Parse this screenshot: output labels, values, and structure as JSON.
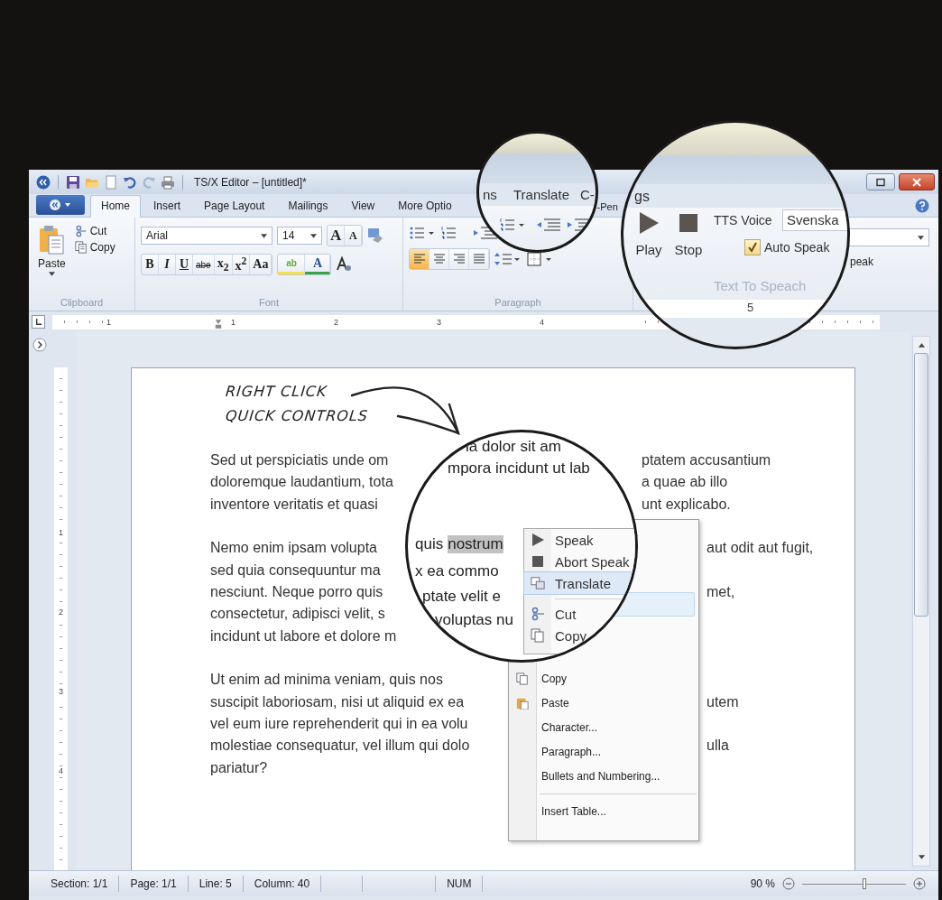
{
  "title_bar": {
    "title": "TS/X Editor – [untitled]*"
  },
  "tabs": [
    {
      "label": "Home",
      "selected": true
    },
    {
      "label": "Insert",
      "selected": false
    },
    {
      "label": "Page Layout",
      "selected": false
    },
    {
      "label": "Mailings",
      "selected": false
    },
    {
      "label": "View",
      "selected": false
    },
    {
      "label": "More Optio",
      "selected": false
    }
  ],
  "tabs_right": [
    {
      "label": "-Pen",
      "selected": false
    }
  ],
  "clipboard": {
    "paste": "Paste",
    "cut": "Cut",
    "copy": "Copy",
    "label": "Clipboard"
  },
  "font": {
    "family": "Arial",
    "size": "14",
    "grow": "A",
    "shrink": "A",
    "format_buttons": [
      "B",
      "I",
      "U",
      "abe",
      "x$_{2}$",
      "x$^{2}$",
      "Aa"
    ],
    "highlight": "ab",
    "color_button": "A",
    "label": "Font"
  },
  "paragraph": {
    "align_buttons": [
      {
        "kind": "left",
        "selected": true
      },
      {
        "kind": "center",
        "selected": false
      },
      {
        "kind": "right",
        "selected": false
      },
      {
        "kind": "justify",
        "selected": false
      }
    ],
    "label": "Paragraph"
  },
  "speak_fragment": "peak",
  "lens_tabs": [
    {
      "label": "ns",
      "selected": false
    },
    {
      "label": "Translate",
      "selected": false
    },
    {
      "label": "C-",
      "selected": false
    }
  ],
  "text_to_speech": {
    "tab_fragment": "gs",
    "play": "Play",
    "stop": "Stop",
    "voice_label": "TTS Voice",
    "voice": "Svenska",
    "auto_speak": {
      "label": "Auto Speak",
      "checked": true
    },
    "label": "Text To Speach",
    "ruler_mark": "5"
  },
  "ruler": {
    "marks": [
      "1",
      "1",
      "2",
      "3",
      "4"
    ]
  },
  "vertical_ruler": {
    "marks": [
      "1",
      "2",
      "3",
      "4"
    ]
  },
  "annotation": {
    "lines": [
      "RIGHT CLICK",
      "QUICK CONTROLS"
    ]
  },
  "document": {
    "paragraphs": [
      {
        "lines": [
          {
            "left": "Sed ut perspiciatis unde om",
            "right": "ptatem accusantium"
          },
          {
            "left": "doloremque laudantium, tota",
            "right": "a quae ab illo"
          },
          {
            "left": "inventore veritatis et quasi",
            "right": "unt explicabo."
          }
        ]
      },
      {
        "lines": [
          {
            "left": "Nemo enim ipsam volupta",
            "right": "aut odit aut fugit,"
          },
          {
            "left": "sed quia consequuntur ma"
          },
          {
            "left": "nesciunt. Neque porro quis",
            "right": "met,"
          },
          {
            "left": "consectetur, adipisci velit, s"
          },
          {
            "left": "incidunt ut labore et dolore m"
          }
        ]
      },
      {
        "lines": [
          {
            "left": "Ut enim ad minima veniam, quis nos"
          },
          {
            "left": "suscipit laboriosam, nisi ut aliquid ex ea",
            "right": "utem"
          },
          {
            "left": "vel eum iure reprehenderit qui in ea volu"
          },
          {
            "left": "molestiae consequatur, vel illum qui dolo",
            "right": "ulla"
          },
          {
            "left": "pariatur?"
          }
        ]
      }
    ]
  },
  "magnified_document": {
    "lines": [
      {
        "text": "ia dolor sit am"
      },
      {
        "text": "mpora incidunt ut lab"
      },
      {
        "text": "quis",
        "highlight": "nostrum"
      },
      {
        "text": "x ea commo"
      },
      {
        "text": "ptate velit e"
      },
      {
        "text": "voluptas nu"
      }
    ]
  },
  "context_menu": {
    "magnified_items": [
      {
        "kind": "speak",
        "label": "Speak",
        "selected": false
      },
      {
        "kind": "stop",
        "label": "Abort Speak",
        "selected": false
      },
      {
        "kind": "translate",
        "label": "Translate",
        "selected": true
      },
      {
        "kind": "separator"
      },
      {
        "kind": "cut",
        "label": "Cut",
        "selected": false
      },
      {
        "kind": "copy",
        "label": "Copy",
        "selected": false
      }
    ],
    "items": [
      {
        "kind": "copy",
        "label": "Copy"
      },
      {
        "kind": "paste",
        "label": "Paste"
      },
      {
        "kind": "plain",
        "label": "Character..."
      },
      {
        "kind": "plain",
        "label": "Paragraph..."
      },
      {
        "kind": "plain",
        "label": "Bullets and Numbering..."
      },
      {
        "kind": "separator"
      },
      {
        "kind": "plain",
        "label": "Insert Table..."
      }
    ]
  },
  "status_bar": {
    "fields": [
      {
        "text": "Section: 1/1"
      },
      {
        "text": "Page: 1/1"
      },
      {
        "text": "Line: 5"
      },
      {
        "text": "Column: 40"
      }
    ],
    "num": "NUM",
    "zoom": "90 %",
    "zoom_slider": {
      "level": 0.6
    }
  }
}
